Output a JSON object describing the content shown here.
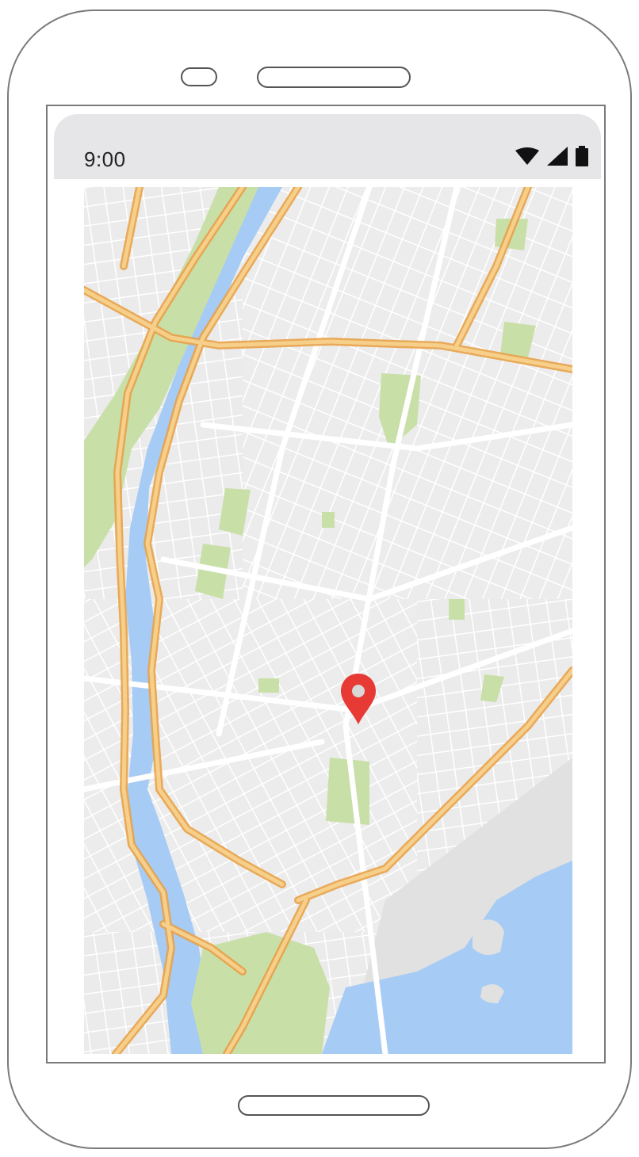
{
  "status_bar": {
    "time": "9:00",
    "icons": [
      "wifi-icon",
      "cell-signal-icon",
      "battery-icon"
    ]
  },
  "map": {
    "marker": "location-pin-icon",
    "colors": {
      "land": "#efefef",
      "water": "#a6cbf5",
      "park": "#c9dfa8",
      "highway": "#f3c57a",
      "road": "#ffffff",
      "marker": "#e83a35"
    }
  }
}
